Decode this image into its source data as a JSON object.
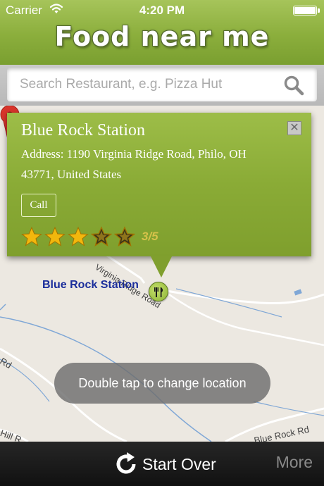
{
  "status_bar": {
    "carrier": "Carrier",
    "time": "4:20 PM"
  },
  "header": {
    "logo_text_1": "Food",
    "logo_text_2": "near me"
  },
  "search": {
    "placeholder": "Search Restaurant, e.g. Pizza Hut",
    "value": ""
  },
  "map": {
    "place_label": "Blue Rock Station",
    "road_labels": [
      "Virginia Ridge Road",
      "Rd",
      "Blue Rock Rd",
      "Hill R"
    ]
  },
  "callout": {
    "title": "Blue Rock Station",
    "address": "Address: 1190 Virginia Ridge Road, Philo, OH 43771, United States",
    "call_label": "Call",
    "rating": 3,
    "rating_max": 5,
    "rating_text": "3/5",
    "close_symbol": "✕"
  },
  "toast": {
    "text": "Double tap to change location"
  },
  "bottom_bar": {
    "start_over_label": "Start Over",
    "more_label": "More"
  },
  "icons": [
    "wifi-icon",
    "battery-icon",
    "search-icon",
    "close-icon",
    "star-icon",
    "restaurant-marker-icon",
    "map-pin-icon",
    "refresh-icon"
  ],
  "colors": {
    "header_green": "#8bae3c",
    "callout_green": "#8aab36",
    "place_label_blue": "#1a2d9b",
    "pin_red": "#d9352b",
    "star_gold": "#f2b70d"
  }
}
